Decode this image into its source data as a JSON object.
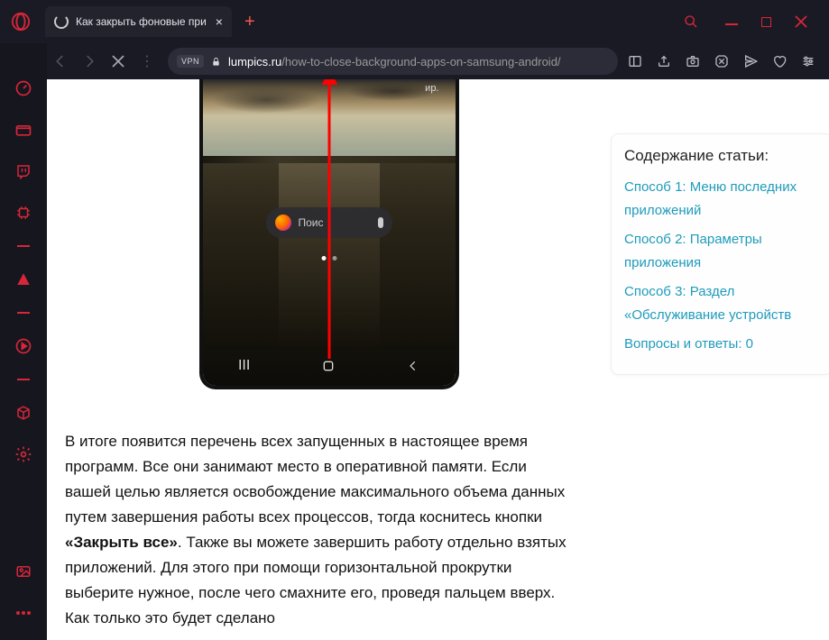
{
  "titlebar": {
    "tab_label": "Как закрыть фоновые при",
    "new_tab_glyph": "+"
  },
  "url": {
    "vpn": "VPN",
    "domain": "lumpics.ru",
    "path": "/how-to-close-background-apps-on-samsung-android/"
  },
  "phone": {
    "status_text": "ир.",
    "search_placeholder": "Поис"
  },
  "article": {
    "p1_a": "В итоге появится перечень всех запущенных в настоящее время программ. Все они занимают место в оперативной памяти. Если вашей целью является освобождение максимального объема данных путем завершения работы всех процессов, тогда коснитесь кнопки ",
    "p1_strong": "«Закрыть все»",
    "p1_b": ". Также вы можете завершить работу отдельно взятых приложений. Для этого при помощи горизонтальной прокрутки выберите нужное, после чего смахните его, проведя пальцем вверх. Как только это будет сделано"
  },
  "toc": {
    "title": "Содержание статьи:",
    "items": [
      "Способ 1: Меню последних приложений",
      "Способ 2: Параметры приложения",
      "Способ 3: Раздел «Обслуживание устройств",
      "Вопросы и ответы: 0"
    ]
  }
}
